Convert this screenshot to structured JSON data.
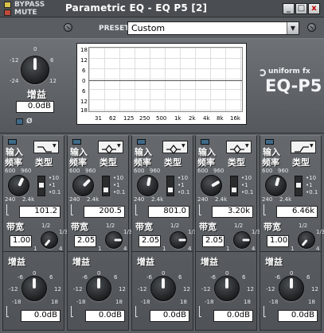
{
  "titlebar": {
    "title": "Parametric EQ - EQ P5 [2]",
    "bypass_label": "BYPASS",
    "mute_label": "MUTE",
    "minimize_glyph": "_",
    "restore_glyph": "□",
    "close_glyph": "x"
  },
  "preset": {
    "label": "PRESET",
    "value": "Custom"
  },
  "master_gain": {
    "label": "增益",
    "value": "0.0dB",
    "scale": [
      "-12",
      "-24",
      "0",
      "6",
      "12"
    ],
    "phase_symbol": "Ø"
  },
  "graph": {
    "y_ticks": [
      "18",
      "12",
      "6",
      "0",
      "6",
      "12",
      "18"
    ],
    "x_ticks": [
      "31",
      "62",
      "125",
      "250",
      "500",
      "1k",
      "2k",
      "4k",
      "8k",
      "16k"
    ]
  },
  "brand": {
    "maker": "uniform fx",
    "model": "EQ-P5"
  },
  "band_labels": {
    "input": "输入",
    "freq": "频率",
    "type": "类型",
    "bandwidth": "带宽",
    "gain": "增益",
    "freq_scale": [
      "600",
      "960",
      "240",
      "2.4k"
    ],
    "bw_scale": [
      "1/2",
      "1/3",
      "1",
      "4"
    ],
    "gain_scale": [
      "0",
      "-6",
      "6",
      "-12",
      "12",
      "-18",
      "18"
    ],
    "type_options": [
      "10",
      "1",
      "0.1"
    ]
  },
  "bands": [
    {
      "freq": "101.2",
      "bw": "1.00",
      "gain": "0.0dB",
      "filter": "low-shelf"
    },
    {
      "freq": "200.5",
      "bw": "2.05",
      "gain": "0.0dB",
      "filter": "peak"
    },
    {
      "freq": "801.0",
      "bw": "2.05",
      "gain": "0.0dB",
      "filter": "peak"
    },
    {
      "freq": "3.20k",
      "bw": "2.05",
      "gain": "0.0dB",
      "filter": "peak"
    },
    {
      "freq": "6.46k",
      "bw": "1.00",
      "gain": "0.0dB",
      "filter": "high-shelf"
    }
  ],
  "colors": {
    "panel": "#5a5e62",
    "led_blue": "#3f6a8a",
    "bypass_led": "#d9c34a",
    "mute_led": "#c04a3a"
  }
}
